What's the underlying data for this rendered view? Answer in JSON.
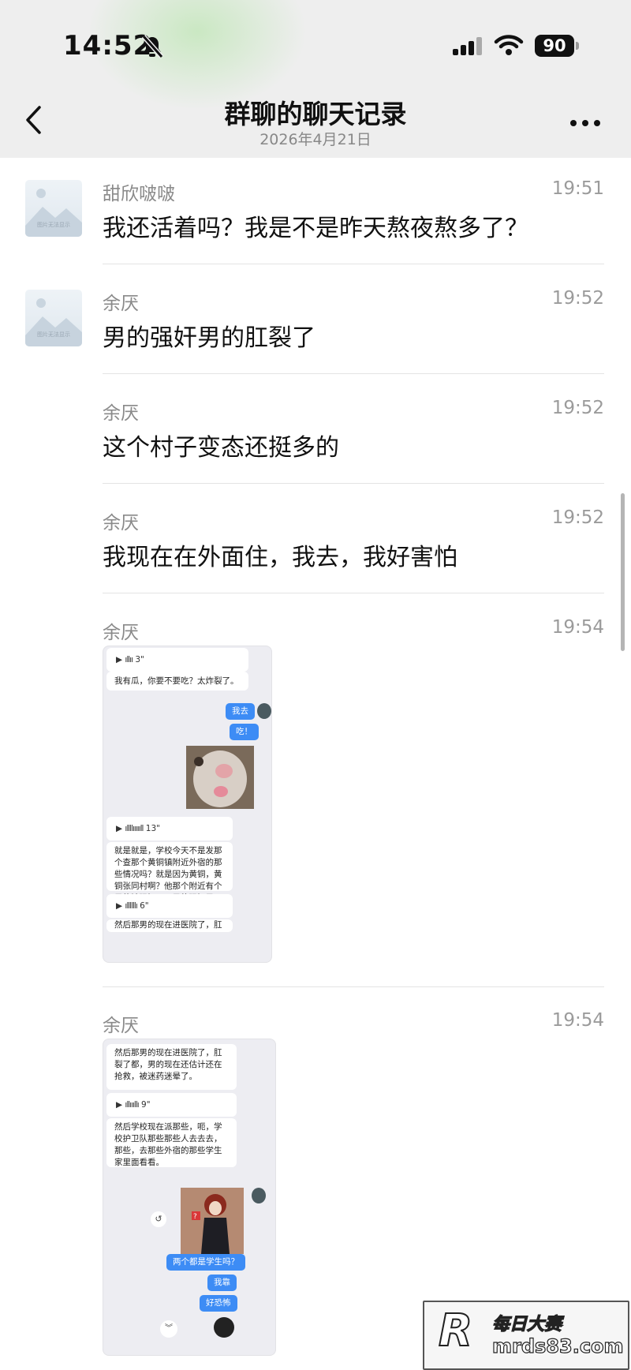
{
  "status_bar": {
    "time": "14:52",
    "battery": "90"
  },
  "header": {
    "title": "群聊的聊天记录",
    "date": "2026年4月21日"
  },
  "messages": [
    {
      "sender": "甜欣啵啵",
      "time": "19:51",
      "text": "我还活着吗？我是不是昨天熬夜熬多了？"
    },
    {
      "sender": "余厌",
      "time": "19:52",
      "text": "男的强奸男的肛裂了"
    },
    {
      "sender": "余厌",
      "time": "19:52",
      "text": "这个村子变态还挺多的"
    },
    {
      "sender": "余厌",
      "time": "19:52",
      "text": "我现在在外面住，我去，我好害怕"
    },
    {
      "sender": "余厌",
      "time": "19:54"
    },
    {
      "sender": "余厌",
      "time": "19:54"
    }
  ],
  "avatar_text": "图片无法显示",
  "shot1": {
    "voice1": "3\"",
    "text1": "我有瓜，你要不要吃？太炸裂了。",
    "bubble1": "我去",
    "bubble2": "吃！",
    "voice2": "13\"",
    "text2": "就是就是，学校今天不是发那个查那个黄铜镇附近外宿的那些情况吗？就是因为黄铜，黄铜张同村啊？他那个附近有个男的被强奸了。男的强奸男的。",
    "voice3": "6\"",
    "text3": "然后那男的现在进医院了，肛裂"
  },
  "shot2": {
    "text1": "然后那男的现在进医院了，肛裂了都，男的现在还估计还在抢救，被迷药迷晕了。",
    "voice1": "9\"",
    "text2": "然后学校现在派那些，呃，学校护卫队那些那些人去去去，那些，去那些外宿的那些学生家里面看看。",
    "bubble1": "两个都是学生吗？",
    "bubble2": "我靠",
    "bubble3": "好恐怖"
  },
  "watermark": {
    "cn": "每日大赛",
    "en": "mrds83.com"
  }
}
